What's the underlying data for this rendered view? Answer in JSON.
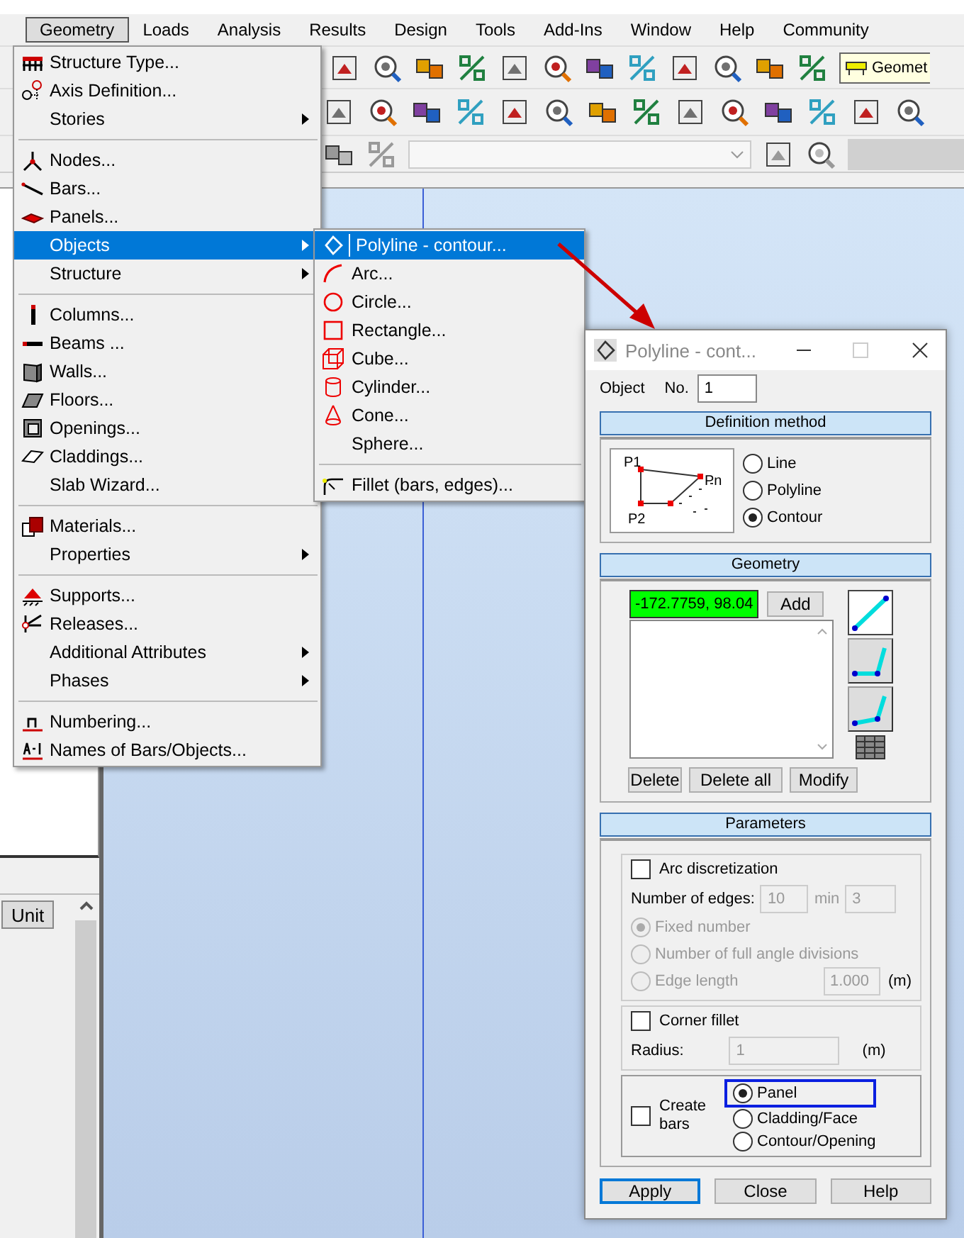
{
  "menu_bar": [
    {
      "label": "Geometry",
      "selected": true
    },
    {
      "label": "Loads",
      "selected": false
    },
    {
      "label": "Analysis",
      "selected": false
    },
    {
      "label": "Results",
      "selected": false
    },
    {
      "label": "Design",
      "selected": false
    },
    {
      "label": "Tools",
      "selected": false
    },
    {
      "label": "Add-Ins",
      "selected": false
    },
    {
      "label": "Window",
      "selected": false
    },
    {
      "label": "Help",
      "selected": false
    },
    {
      "label": "Community",
      "selected": false
    }
  ],
  "toolbar_combo": {
    "value": "Geomet"
  },
  "geometry_menu": {
    "items": [
      {
        "kind": "item",
        "label": "Structure Type...",
        "submenu": false,
        "selected": false
      },
      {
        "kind": "item",
        "label": "Axis Definition...",
        "submenu": false,
        "selected": false
      },
      {
        "kind": "item",
        "label": "Stories",
        "submenu": true,
        "selected": false
      },
      {
        "kind": "separator"
      },
      {
        "kind": "item",
        "label": "Nodes...",
        "submenu": false,
        "selected": false
      },
      {
        "kind": "item",
        "label": "Bars...",
        "submenu": false,
        "selected": false
      },
      {
        "kind": "item",
        "label": "Panels...",
        "submenu": false,
        "selected": false
      },
      {
        "kind": "item",
        "label": "Objects",
        "submenu": true,
        "selected": true
      },
      {
        "kind": "item",
        "label": "Structure",
        "submenu": true,
        "selected": false
      },
      {
        "kind": "separator"
      },
      {
        "kind": "item",
        "label": "Columns...",
        "submenu": false,
        "selected": false
      },
      {
        "kind": "item",
        "label": "Beams ...",
        "submenu": false,
        "selected": false
      },
      {
        "kind": "item",
        "label": "Walls...",
        "submenu": false,
        "selected": false
      },
      {
        "kind": "item",
        "label": "Floors...",
        "submenu": false,
        "selected": false
      },
      {
        "kind": "item",
        "label": "Openings...",
        "submenu": false,
        "selected": false
      },
      {
        "kind": "item",
        "label": "Claddings...",
        "submenu": false,
        "selected": false
      },
      {
        "kind": "item",
        "label": "Slab Wizard...",
        "submenu": false,
        "selected": false
      },
      {
        "kind": "separator"
      },
      {
        "kind": "item",
        "label": "Materials...",
        "submenu": false,
        "selected": false
      },
      {
        "kind": "item",
        "label": "Properties",
        "submenu": true,
        "selected": false
      },
      {
        "kind": "separator"
      },
      {
        "kind": "item",
        "label": "Supports...",
        "submenu": false,
        "selected": false
      },
      {
        "kind": "item",
        "label": "Releases...",
        "submenu": false,
        "selected": false
      },
      {
        "kind": "item",
        "label": "Additional Attributes",
        "submenu": true,
        "selected": false
      },
      {
        "kind": "item",
        "label": "Phases",
        "submenu": true,
        "selected": false
      },
      {
        "kind": "separator"
      },
      {
        "kind": "item",
        "label": "Numbering...",
        "submenu": false,
        "selected": false
      },
      {
        "kind": "item",
        "label": "Names of Bars/Objects...",
        "submenu": false,
        "selected": false
      }
    ]
  },
  "objects_submenu": {
    "items": [
      {
        "kind": "item",
        "label": "Polyline - contour...",
        "submenu": false,
        "selected": true
      },
      {
        "kind": "item",
        "label": "Arc...",
        "submenu": false,
        "selected": false
      },
      {
        "kind": "item",
        "label": "Circle...",
        "submenu": false,
        "selected": false
      },
      {
        "kind": "item",
        "label": "Rectangle...",
        "submenu": false,
        "selected": false
      },
      {
        "kind": "item",
        "label": "Cube...",
        "submenu": false,
        "selected": false
      },
      {
        "kind": "item",
        "label": "Cylinder...",
        "submenu": false,
        "selected": false
      },
      {
        "kind": "item",
        "label": "Cone...",
        "submenu": false,
        "selected": false
      },
      {
        "kind": "item",
        "label": "Sphere...",
        "submenu": false,
        "selected": false
      },
      {
        "kind": "separator"
      },
      {
        "kind": "item",
        "label": "Fillet (bars, edges)...",
        "submenu": false,
        "selected": false
      }
    ]
  },
  "dialog": {
    "title": "Polyline - cont...",
    "object_label": "Object",
    "number_label": "No.",
    "number_value": "1",
    "definition_header": "Definition method",
    "diagram_labels": [
      "P1",
      "Pn",
      "P2"
    ],
    "methods": [
      {
        "label": "Line",
        "selected": false
      },
      {
        "label": "Polyline",
        "selected": false
      },
      {
        "label": "Contour",
        "selected": true
      }
    ],
    "geometry_header": "Geometry",
    "point_value": "-172.7759, 98.04",
    "add_button": "Add",
    "list_buttons": [
      "Delete",
      "Delete all",
      "Modify"
    ],
    "parameters_header": "Parameters",
    "arc": {
      "label": "Arc discretization",
      "checked": false,
      "disabled": true,
      "edges_label": "Number of edges:",
      "edges_value": "10",
      "min_label": "min",
      "min_value": "3",
      "length_value": "1.000",
      "length_unit": "(m)",
      "modes": [
        {
          "label": "Fixed number",
          "selected": true
        },
        {
          "label": "Number of full angle divisions",
          "selected": false
        },
        {
          "label": "Edge length",
          "selected": false
        }
      ]
    },
    "fillet": {
      "label": "Corner fillet",
      "checked": false,
      "disabled": true,
      "radius_label": "Radius:",
      "radius_value": "1",
      "radius_unit": "(m)"
    },
    "bars": {
      "label": "Create bars",
      "checked": false,
      "targets": [
        {
          "label": "Panel",
          "selected": true,
          "highlighted": true
        },
        {
          "label": "Cladding/Face",
          "selected": false,
          "highlighted": false
        },
        {
          "label": "Contour/Opening",
          "selected": false,
          "highlighted": false
        }
      ]
    },
    "buttons": [
      {
        "label": "Apply",
        "focused": true
      },
      {
        "label": "Close",
        "focused": false
      },
      {
        "label": "Help",
        "focused": false
      }
    ]
  },
  "left_panel": {
    "column_header": "Unit"
  }
}
